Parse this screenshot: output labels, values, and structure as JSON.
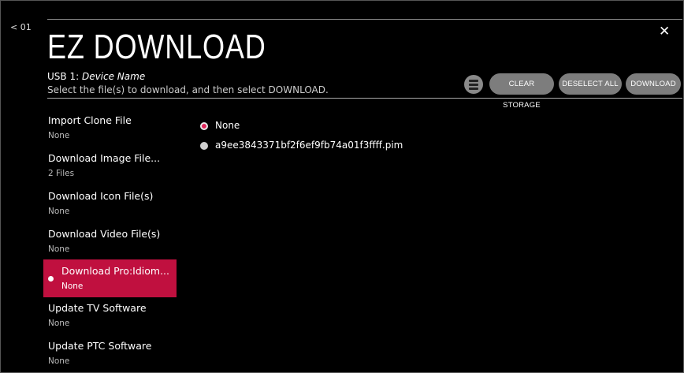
{
  "header": {
    "back_label": "< 01",
    "title": "EZ DOWNLOAD",
    "close_label": "✕",
    "device_prefix": "USB 1: ",
    "device_name": "Device Name",
    "instruction": "Select the file(s) to download, and then select DOWNLOAD."
  },
  "toolbar": {
    "storage_icon": "storage-icon",
    "clear_storage_label": "CLEAR STORAGE",
    "deselect_all_label": "DESELECT ALL",
    "download_label": "DOWNLOAD"
  },
  "sidebar": {
    "items": [
      {
        "label": "Import Clone File",
        "value": "None"
      },
      {
        "label": "Download Image File...",
        "value": "2 Files"
      },
      {
        "label": "Download Icon File(s)",
        "value": "None"
      },
      {
        "label": "Download Video File(s)",
        "value": "None"
      },
      {
        "label": "Download Pro:Idiom...",
        "value": "None",
        "selected": true
      },
      {
        "label": "Update TV Software",
        "value": "None"
      },
      {
        "label": "Update PTC Software",
        "value": "None"
      }
    ]
  },
  "files": {
    "options": [
      {
        "name": "None",
        "checked": true
      },
      {
        "name": "a9ee3843371bf2f6ef9fb74a01f3ffff.pim",
        "checked": false
      }
    ]
  },
  "colors": {
    "accent": "#c0103f",
    "button": "#7d7d7d",
    "background": "#000000"
  }
}
